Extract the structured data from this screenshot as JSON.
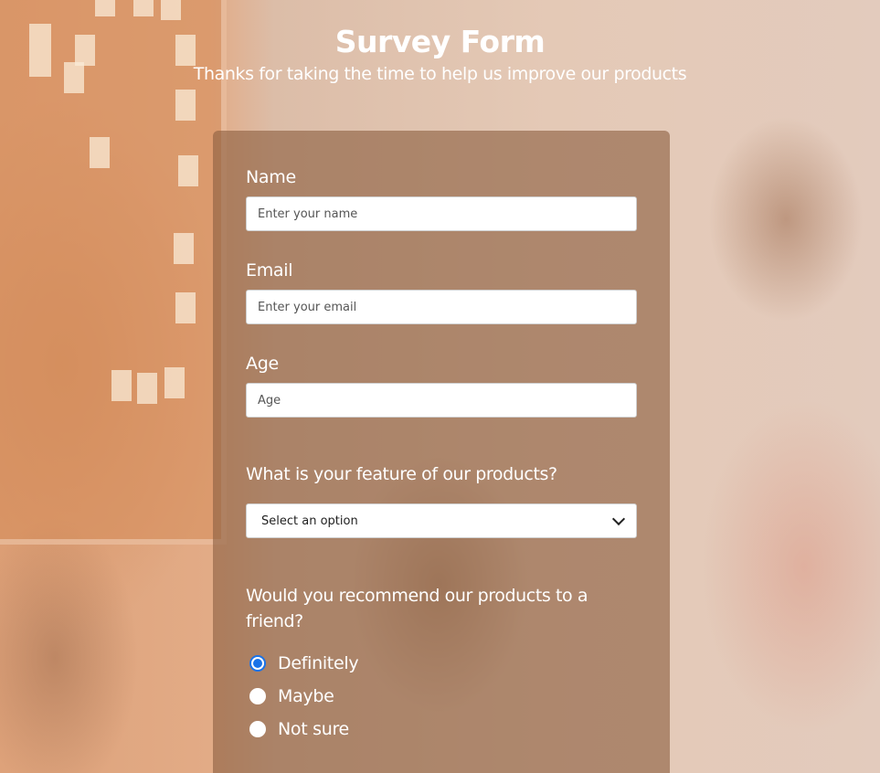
{
  "header": {
    "title": "Survey Form",
    "subtitle": "Thanks for taking the time to help us improve our products"
  },
  "form": {
    "name": {
      "label": "Name",
      "placeholder": "Enter your name",
      "value": ""
    },
    "email": {
      "label": "Email",
      "placeholder": "Enter your email",
      "value": ""
    },
    "age": {
      "label": "Age",
      "placeholder": "Age",
      "value": ""
    },
    "feature": {
      "question": "What is your feature of our products?",
      "selected": "Select an option"
    },
    "recommend": {
      "question": "Would you recommend our products to a friend?",
      "options": [
        {
          "label": "Definitely",
          "checked": true
        },
        {
          "label": "Maybe",
          "checked": false
        },
        {
          "label": "Not sure",
          "checked": false
        }
      ]
    }
  },
  "colors": {
    "card_overlay": "#8c5f41",
    "radio_accent": "#1a73e8",
    "text": "#ffffff"
  }
}
